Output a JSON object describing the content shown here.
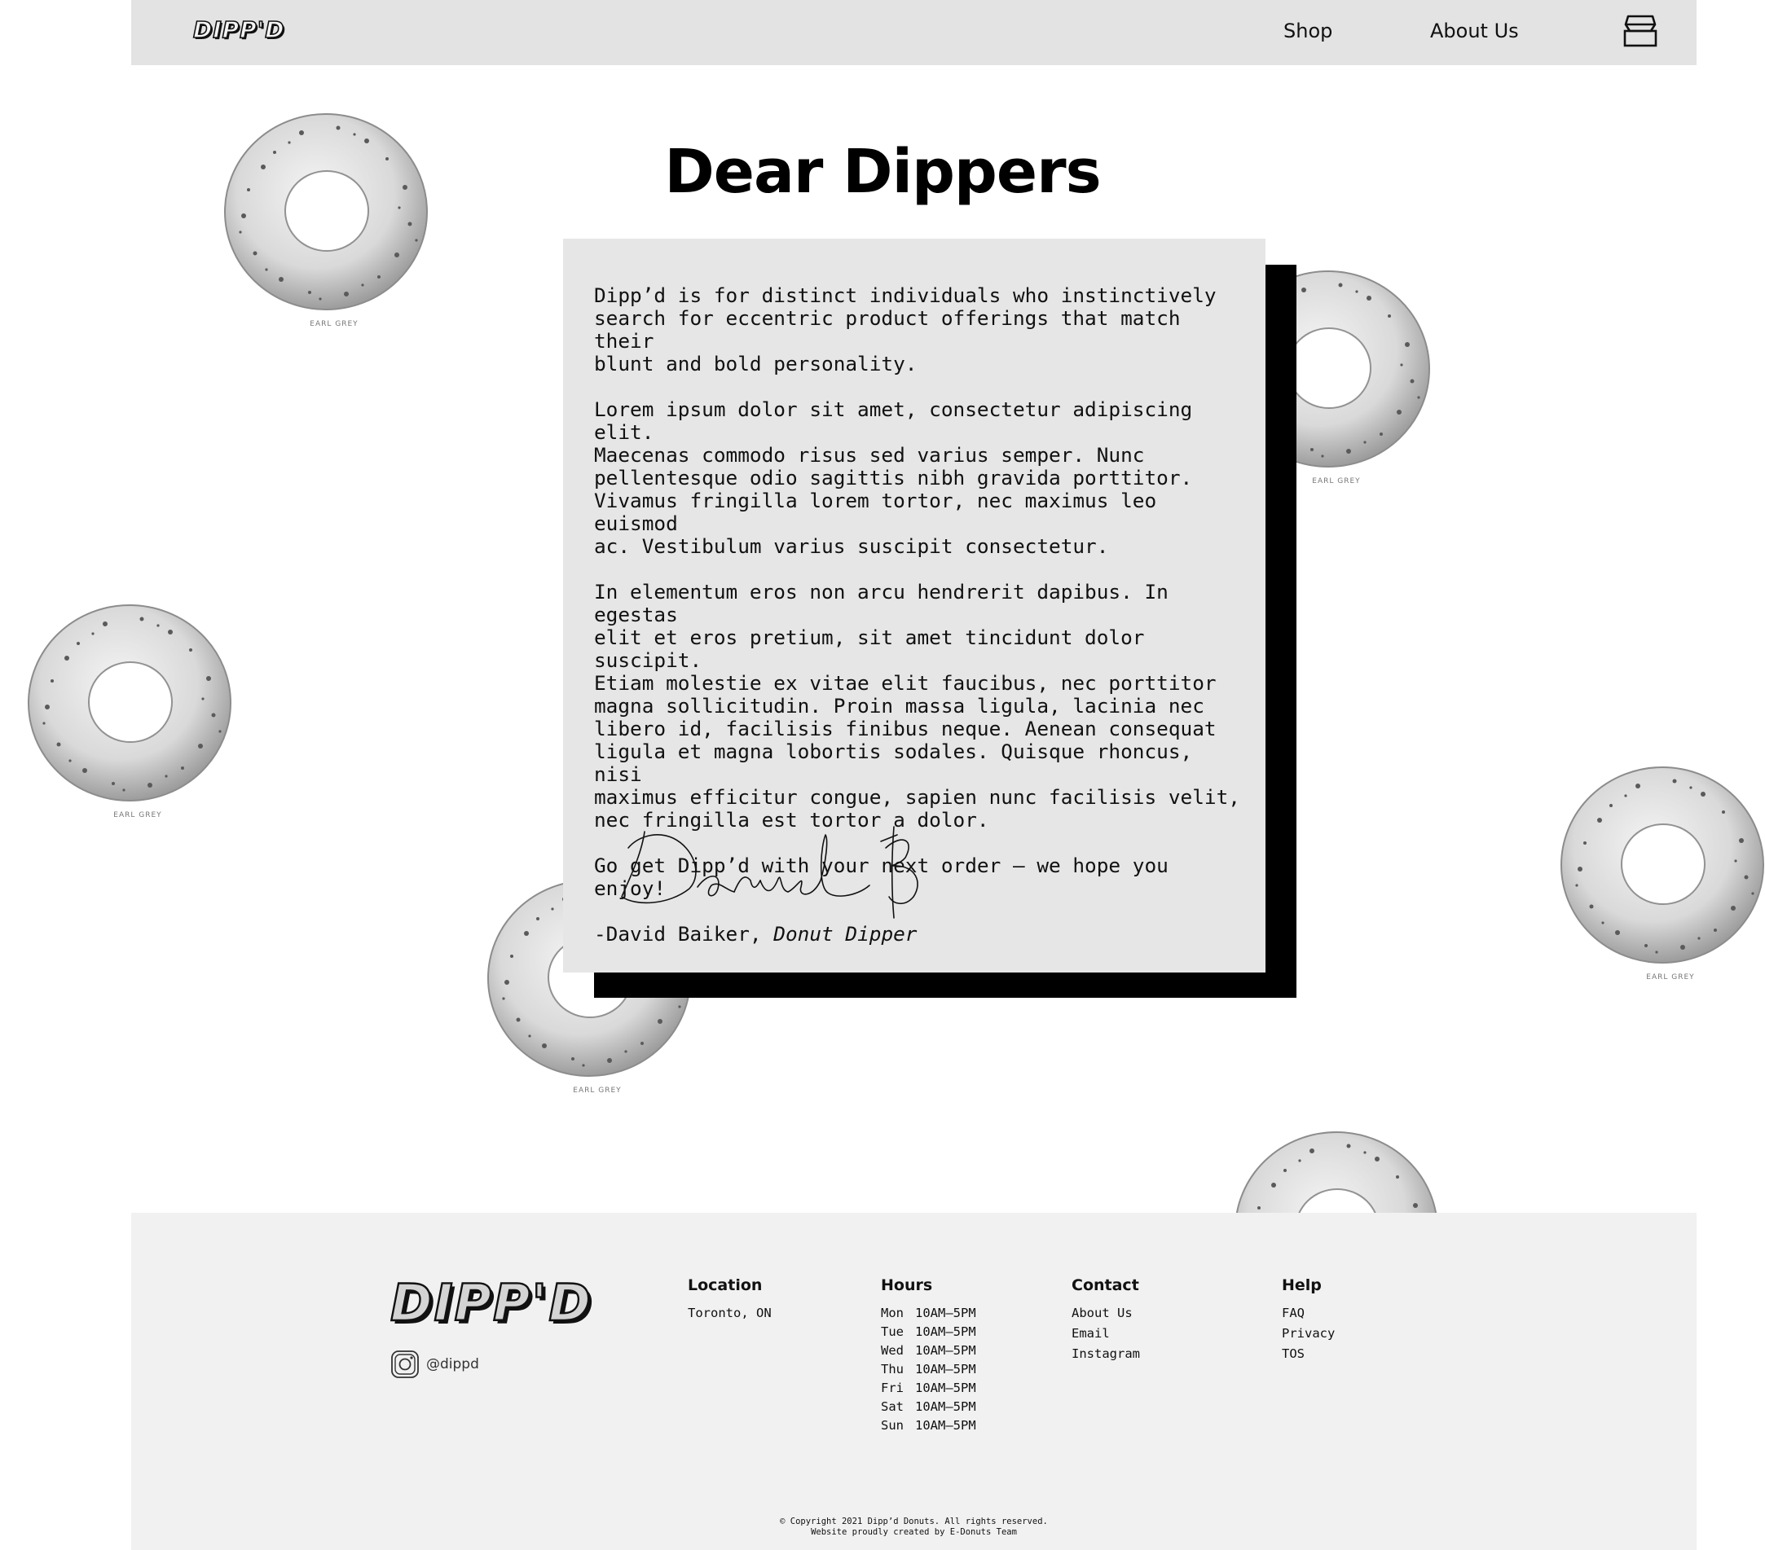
{
  "header": {
    "logo_text": "DIPP'D",
    "nav": {
      "shop_label": "Shop",
      "about_label": "About Us"
    },
    "cart_icon": "box-icon"
  },
  "main": {
    "title": "Dear Dippers",
    "letter": {
      "paragraphs": [
        "Dipp’d is for distinct individuals who instinctively\nsearch for eccentric product offerings that match their\nblunt and bold personality.",
        "Lorem ipsum dolor sit amet, consectetur adipiscing elit.\nMaecenas commodo risus sed varius semper. Nunc\npellentesque odio sagittis nibh gravida porttitor.\nVivamus fringilla lorem tortor, nec maximus leo euismod\nac. Vestibulum varius suscipit consectetur.",
        "In elementum eros non arcu hendrerit dapibus. In egestas\nelit et eros pretium, sit amet tincidunt dolor suscipit.\nEtiam molestie ex vitae elit faucibus, nec porttitor\nmagna sollicitudin. Proin massa ligula, lacinia nec\nlibero id, facilisis finibus neque. Aenean consequat\nligula et magna lobortis sodales. Quisque rhoncus, nisi\nmaximus efficitur congue, sapien nunc facilisis velit,\nnec fringilla est tortor a dolor.",
        "Go get Dipp’d with your next order – we hope you enjoy!"
      ],
      "sign_name": "-David Baiker, ",
      "sign_role": "Donut Dipper"
    },
    "donut_label": "EARL GREY"
  },
  "footer": {
    "logo_text": "DIPP'D",
    "instagram_handle": "@dippd",
    "location": {
      "heading": "Location",
      "value": "Toronto, ON"
    },
    "hours": {
      "heading": "Hours",
      "rows": [
        {
          "day": "Mon",
          "time": "10AM–5PM"
        },
        {
          "day": "Tue",
          "time": "10AM–5PM"
        },
        {
          "day": "Wed",
          "time": "10AM–5PM"
        },
        {
          "day": "Thu",
          "time": "10AM–5PM"
        },
        {
          "day": "Fri",
          "time": "10AM–5PM"
        },
        {
          "day": "Sat",
          "time": "10AM–5PM"
        },
        {
          "day": "Sun",
          "time": "10AM–5PM"
        }
      ]
    },
    "contact": {
      "heading": "Contact",
      "links": [
        "About Us",
        "Email",
        "Instagram"
      ]
    },
    "help": {
      "heading": "Help",
      "links": [
        "FAQ",
        "Privacy",
        "TOS"
      ]
    },
    "copyright_line1": "© Copyright 2021 Dipp’d Donuts. All rights reserved.",
    "copyright_line2": "Website proudly created by E-Donuts Team"
  },
  "colors": {
    "header_bg": "#e3e3e3",
    "card_bg": "#e6e6e6",
    "card_shadow": "#000000",
    "footer_bg": "#f1f1f1"
  }
}
